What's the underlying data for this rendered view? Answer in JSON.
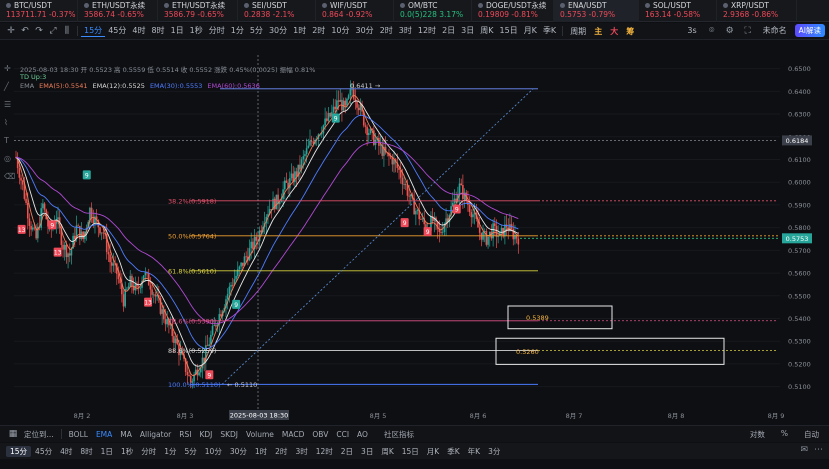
{
  "tickers": [
    {
      "symbol": "BTC/USDT",
      "price": "113711.71",
      "change": "-0.37%",
      "dir": "dn",
      "active": false
    },
    {
      "symbol": "ETH/USDT永续",
      "price": "3586.74",
      "change": "-0.65%",
      "dir": "dn",
      "active": false
    },
    {
      "symbol": "ETH/USDT永续",
      "price": "3586.79",
      "change": "-0.65%",
      "dir": "dn",
      "active": false
    },
    {
      "symbol": "SEI/USDT",
      "price": "0.2838",
      "change": "-2.1%",
      "dir": "dn",
      "active": false
    },
    {
      "symbol": "WIF/USDT",
      "price": "0.864",
      "change": "-0.92%",
      "dir": "dn",
      "active": false
    },
    {
      "symbol": "OM/BTC",
      "price": "0.0(5)228",
      "change": "3.17%",
      "dir": "up",
      "active": false
    },
    {
      "symbol": "DOGE/USDT永续",
      "price": "0.19809",
      "change": "-0.81%",
      "dir": "dn",
      "active": false
    },
    {
      "symbol": "ENA/USDT",
      "price": "0.5753",
      "change": "-0.79%",
      "dir": "dn",
      "active": true
    },
    {
      "symbol": "SOL/USDT",
      "price": "163.14",
      "change": "-0.58%",
      "dir": "dn",
      "active": false
    },
    {
      "symbol": "XRP/USDT",
      "price": "2.9368",
      "change": "-0.86%",
      "dir": "dn",
      "active": false
    }
  ],
  "toolbar": {
    "intervals": [
      "15分",
      "45分",
      "4时",
      "8时",
      "1日",
      "1秒",
      "分时",
      "1分",
      "5分",
      "30分",
      "1时",
      "2时",
      "10分",
      "30分",
      "2时",
      "3时",
      "12时",
      "2日",
      "3日",
      "周K",
      "15日",
      "月K",
      "季K"
    ],
    "active_interval": "15分",
    "period_label": "周期",
    "markers": [
      "主",
      "大",
      "筹"
    ],
    "right_items": [
      "3s",
      "未命名"
    ],
    "ai_label": "AI解读"
  },
  "legend": {
    "line1": "2025-08-03 18:30  开 0.5523  高 0.5559  低 0.5514  收 0.5552  涨跌 0.45%(0.0025)  振幅 0.81%",
    "line2": "TD  Up:3",
    "ema_title": "EMA",
    "ema_values": [
      "EMA(5):0.5541",
      "EMA(12):0.5525",
      "EMA(30):0.5553",
      "EMA(60):0.5636"
    ]
  },
  "chart_data": {
    "type": "candlestick",
    "symbol": "ENA/USDT",
    "interval": "15分",
    "ylim": [
      0.505,
      0.656
    ],
    "y_ticks": [
      "0.6500",
      "0.6400",
      "0.6300",
      "0.6200",
      "0.6100",
      "0.6000",
      "0.5900",
      "0.5800",
      "0.5700",
      "0.5600",
      "0.5500",
      "0.5400",
      "0.5300",
      "0.5200",
      "0.5100"
    ],
    "x_ticks": [
      "8月 2",
      "8月 3",
      "8月 4",
      "8月 5",
      "8月 6",
      "8月 7",
      "8月 8",
      "8月 9"
    ],
    "crosshair_date": "2025-08-03 18:30",
    "current_price": "0.5753",
    "crosshair_price": "0.6184",
    "price_path": [
      0.611,
      0.598,
      0.583,
      0.575,
      0.59,
      0.578,
      0.585,
      0.572,
      0.568,
      0.58,
      0.575,
      0.588,
      0.582,
      0.578,
      0.565,
      0.56,
      0.548,
      0.556,
      0.552,
      0.56,
      0.555,
      0.548,
      0.541,
      0.535,
      0.528,
      0.52,
      0.512,
      0.518,
      0.523,
      0.532,
      0.54,
      0.547,
      0.555,
      0.56,
      0.566,
      0.571,
      0.576,
      0.585,
      0.59,
      0.592,
      0.598,
      0.601,
      0.605,
      0.612,
      0.618,
      0.622,
      0.626,
      0.63,
      0.636,
      0.632,
      0.641,
      0.634,
      0.625,
      0.62,
      0.616,
      0.612,
      0.61,
      0.605,
      0.598,
      0.59,
      0.585,
      0.58,
      0.583,
      0.577,
      0.584,
      0.59,
      0.598,
      0.592,
      0.586,
      0.578,
      0.575,
      0.579,
      0.576,
      0.581,
      0.577,
      0.575
    ],
    "fib_levels": [
      {
        "label": "0.6411",
        "value": 0.6411,
        "color": "#6f8fff"
      },
      {
        "label": "38.2%(0.5918)",
        "value": 0.5918,
        "color": "#e0506a"
      },
      {
        "label": "50.0%(0.5764)",
        "value": 0.5764,
        "color": "#f0a030"
      },
      {
        "label": "61.8%(0.5610)",
        "value": 0.561,
        "color": "#d8d040"
      },
      {
        "label": "78.6%(0.5390)",
        "value": 0.539,
        "color": "#e0508a"
      },
      {
        "label": "88.6%(0.5259)",
        "value": 0.5259,
        "color": "#d8d8d8"
      },
      {
        "label": "100.0%(0.5110)",
        "value": 0.511,
        "color": "#4a7bff"
      }
    ],
    "low_label": "0.5110",
    "boxes": [
      {
        "label": "0.5389",
        "top": 0.5455,
        "bottom": 0.5355
      },
      {
        "label": "0.5260",
        "top": 0.5313,
        "bottom": 0.5198
      }
    ],
    "td_markers": [
      {
        "label": "9",
        "x": 0.095,
        "y": 0.603
      },
      {
        "label": "13",
        "x": 0.01,
        "y": 0.579
      },
      {
        "label": "13",
        "x": 0.057,
        "y": 0.569
      },
      {
        "label": "9",
        "x": 0.05,
        "y": 0.581
      },
      {
        "label": "13",
        "x": 0.175,
        "y": 0.547
      },
      {
        "label": "9",
        "x": 0.42,
        "y": 0.628
      },
      {
        "label": "9",
        "x": 0.29,
        "y": 0.546
      },
      {
        "label": "9",
        "x": 0.255,
        "y": 0.515
      },
      {
        "label": "9",
        "x": 0.51,
        "y": 0.582
      },
      {
        "label": "9",
        "x": 0.54,
        "y": 0.578
      },
      {
        "label": "9",
        "x": 0.578,
        "y": 0.588
      }
    ]
  },
  "indicators": {
    "left_label": "定位到...",
    "items": [
      "BOLL",
      "EMA",
      "MA",
      "Alligator",
      "RSI",
      "KDJ",
      "SKDJ",
      "Volume",
      "MACD",
      "OBV",
      "CCI",
      "AO"
    ],
    "active": "EMA",
    "community": "社区指标",
    "right_items": [
      "对数",
      "%",
      "自动"
    ]
  },
  "bottom_intervals": {
    "items": [
      "15分",
      "45分",
      "4时",
      "8时",
      "1日",
      "1秒",
      "分时",
      "1分",
      "5分",
      "10分",
      "30分",
      "1时",
      "2时",
      "3时",
      "12时",
      "2日",
      "3日",
      "周K",
      "15日",
      "月K",
      "季K",
      "年K",
      "3分"
    ],
    "active": "15分"
  }
}
